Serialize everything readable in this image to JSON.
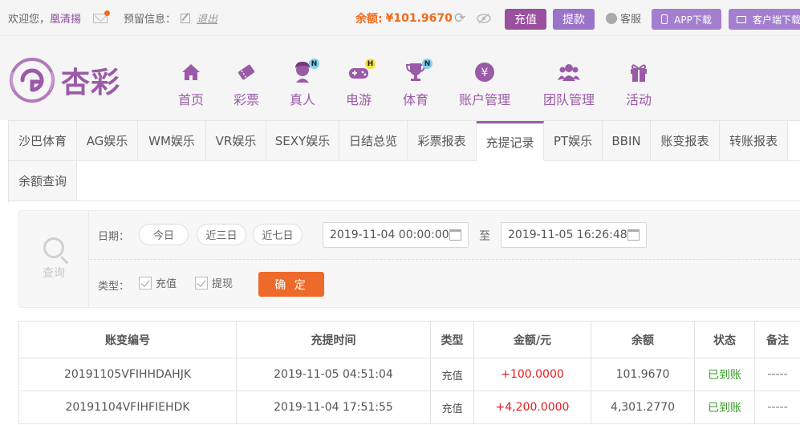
{
  "topbar": {
    "welcome": "欢迎您，",
    "username": "凰清揚",
    "reserved_label": "预留信息：",
    "logout": "退出",
    "balance_label": "余额:",
    "balance_value": "¥101.9670",
    "deposit": "充值",
    "withdraw": "提款",
    "service": "客服",
    "app_download": "APP下载",
    "client_download": "客户端下载"
  },
  "logo": {
    "text": "杏彩"
  },
  "nav": [
    {
      "label": "首页",
      "icon": "home-icon"
    },
    {
      "label": "彩票",
      "icon": "ticket-icon"
    },
    {
      "label": "真人",
      "icon": "dealer-icon",
      "badge": "N"
    },
    {
      "label": "电游",
      "icon": "gamepad-icon",
      "badge": "H"
    },
    {
      "label": "体育",
      "icon": "trophy-icon",
      "badge": "N"
    },
    {
      "label": "账户管理",
      "icon": "yen-coin-icon"
    },
    {
      "label": "团队管理",
      "icon": "team-icon"
    },
    {
      "label": "活动",
      "icon": "gift-icon"
    }
  ],
  "tabs": [
    "沙巴体育",
    "AG娱乐",
    "WM娱乐",
    "VR娱乐",
    "SEXY娱乐",
    "日结总览",
    "彩票报表",
    "充提记录",
    "PT娱乐",
    "BBIN",
    "账变报表",
    "转账报表",
    "余额查询"
  ],
  "filter": {
    "query_label": "查询",
    "date_label": "日期：",
    "today": "今日",
    "three_days": "近三日",
    "seven_days": "近七日",
    "start": "2019-11-04 00:00:00",
    "to": "至",
    "end": "2019-11-05 16:26:48",
    "type_label": "类型：",
    "opt_deposit": "充值",
    "opt_withdraw": "提现",
    "confirm": "确 定"
  },
  "table": {
    "headers": [
      "账变编号",
      "充提时间",
      "类型",
      "金额/元",
      "余额",
      "状态",
      "备注"
    ],
    "rows": [
      [
        "20191105VFIHHDAHJK",
        "2019-11-05 04:51:04",
        "充值",
        "+100.0000",
        "101.9670",
        "已到账",
        "-----"
      ],
      [
        "20191104VFIHFIEHDK",
        "2019-11-04 17:51:55",
        "充值",
        "+4,200.0000",
        "4,301.2770",
        "已到账",
        "-----"
      ]
    ]
  },
  "colors": {
    "brand": "#9b5aa8",
    "accent_orange": "#f06a1a",
    "confirm": "#ee6a2a",
    "success": "#3a9a2a",
    "amount": "#e02020"
  }
}
